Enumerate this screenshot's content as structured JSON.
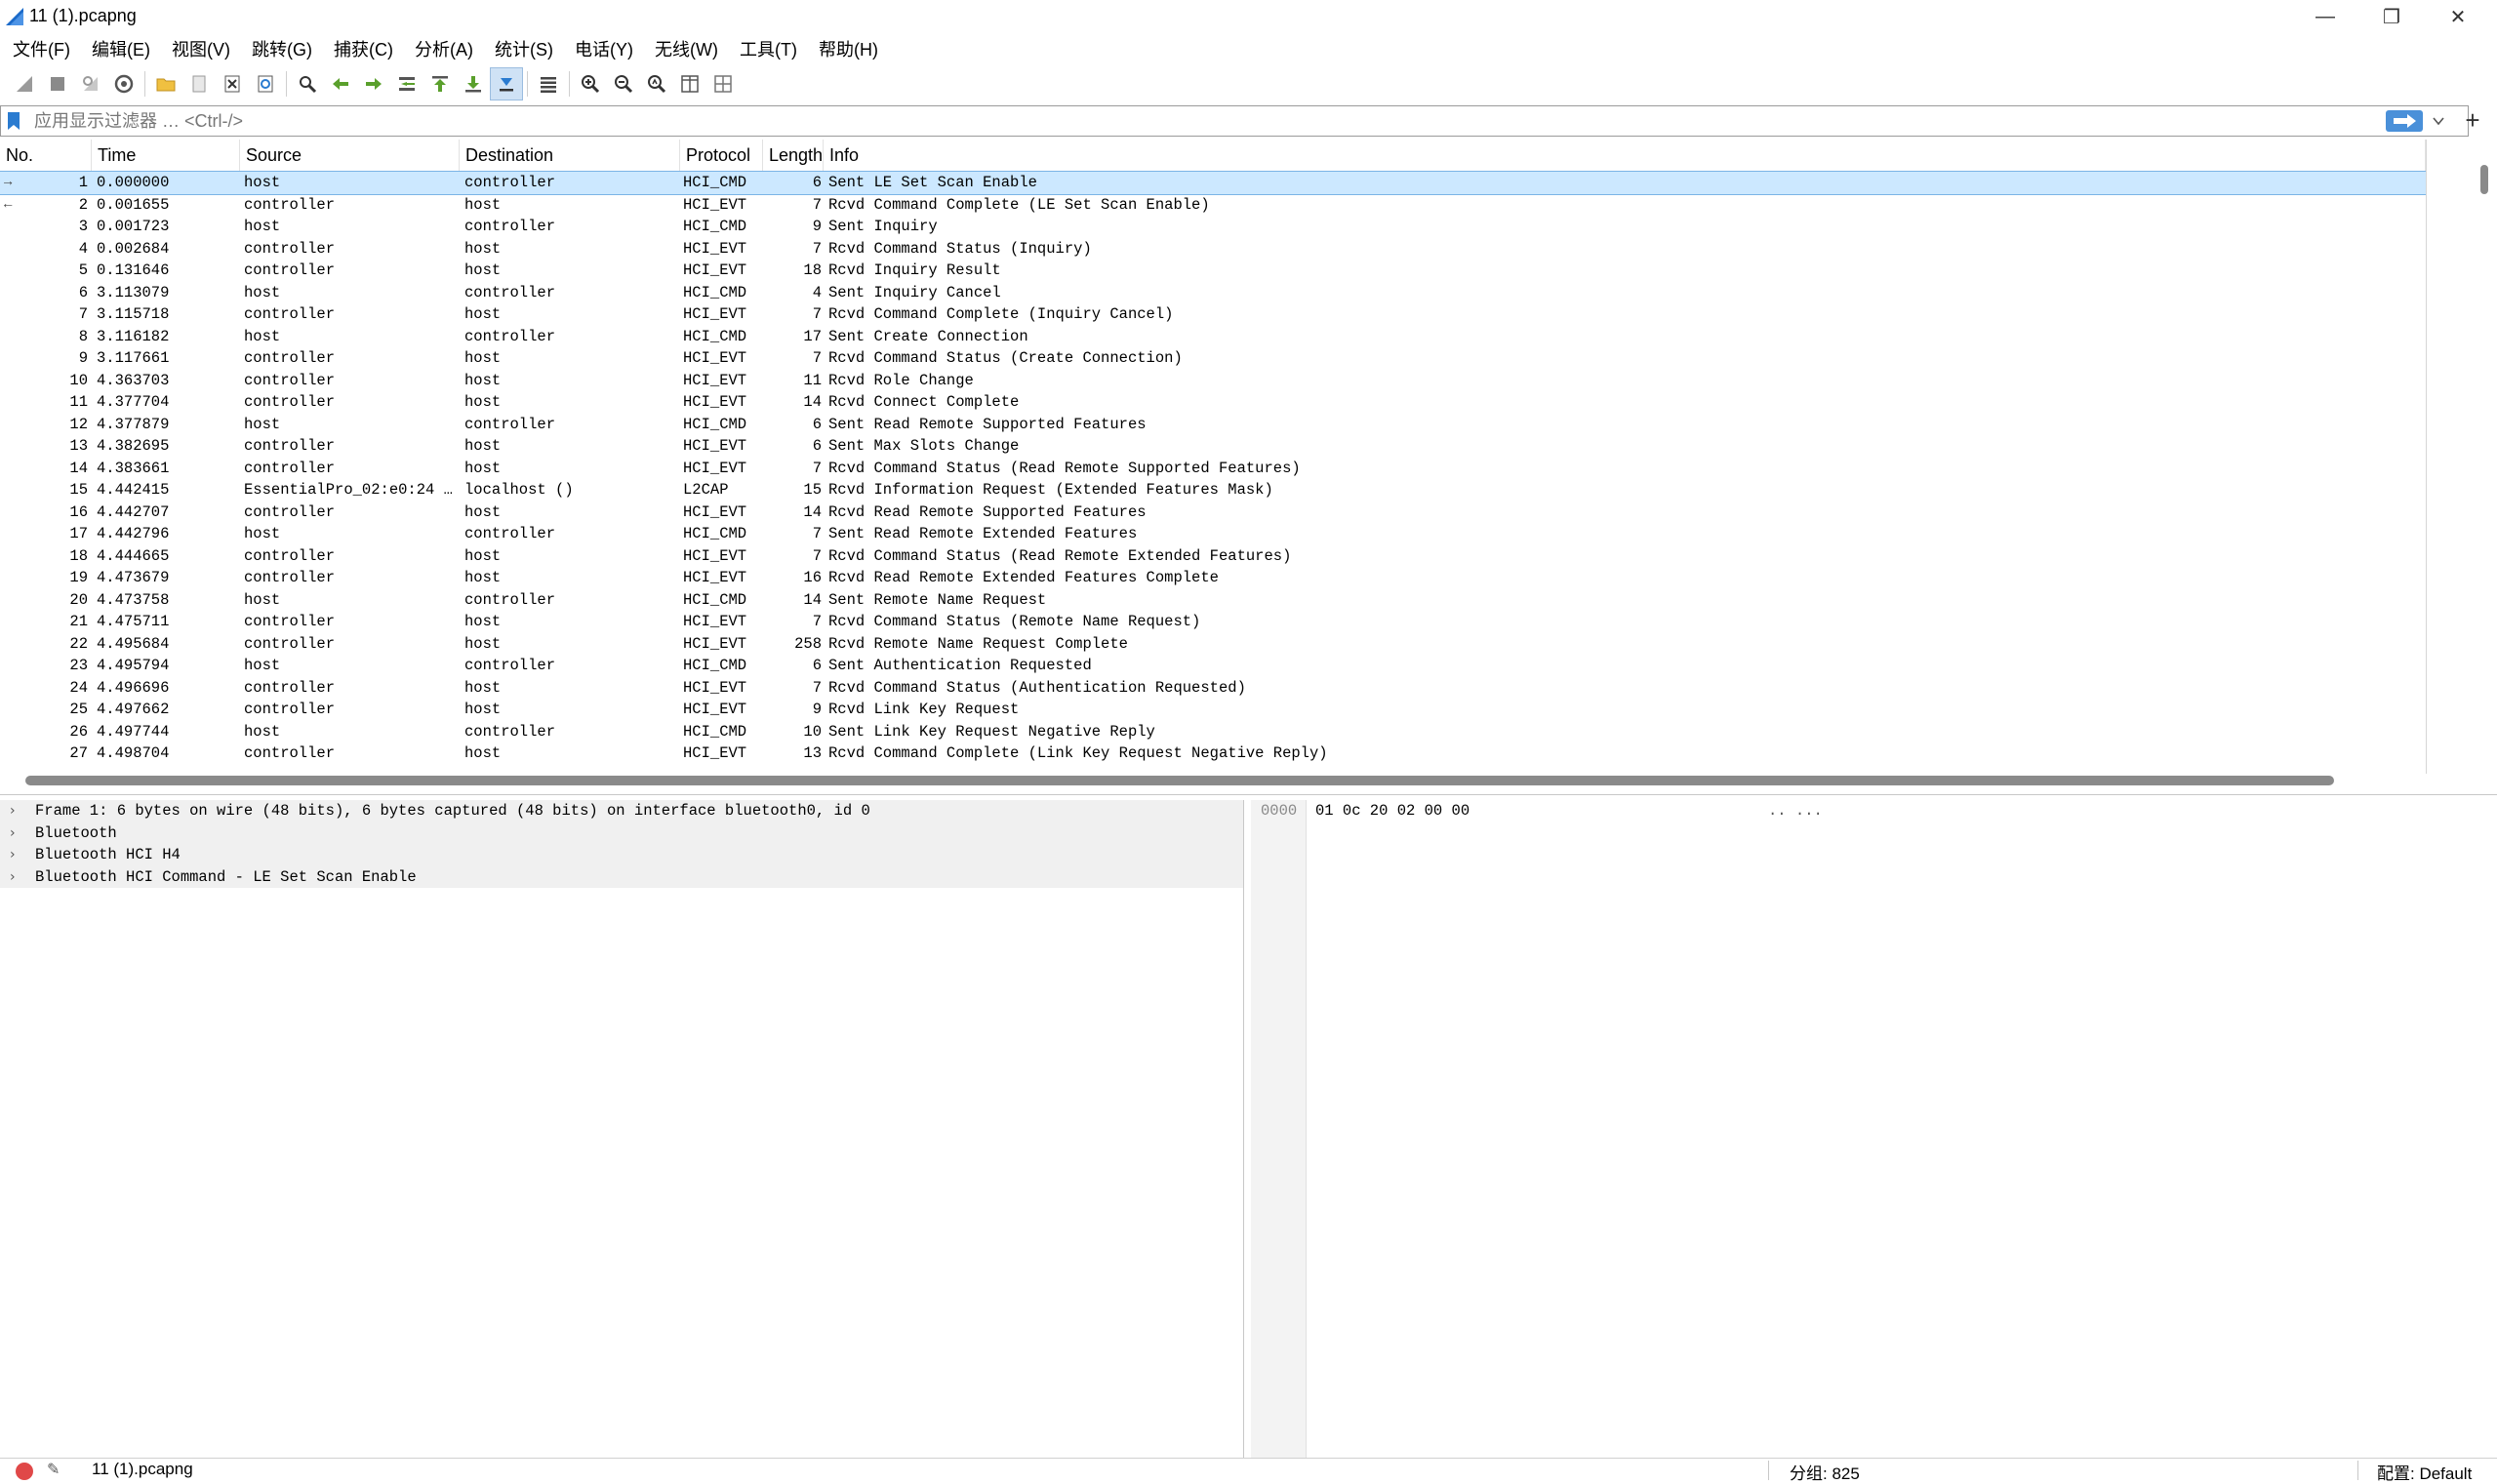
{
  "window": {
    "title": "11 (1).pcapng",
    "controls": [
      "minimize",
      "restore",
      "close"
    ]
  },
  "menu": [
    "文件(F)",
    "编辑(E)",
    "视图(V)",
    "跳转(G)",
    "捕获(C)",
    "分析(A)",
    "统计(S)",
    "电话(Y)",
    "无线(W)",
    "工具(T)",
    "帮助(H)"
  ],
  "filter": {
    "placeholder": "应用显示过滤器 … <Ctrl-/>",
    "value": "",
    "add_label": "+"
  },
  "columns": {
    "no": "No.",
    "time": "Time",
    "source": "Source",
    "destination": "Destination",
    "protocol": "Protocol",
    "length": "Length",
    "info": "Info"
  },
  "packets": [
    {
      "no": "1",
      "time": "0.000000",
      "source": "host",
      "destination": "controller",
      "protocol": "HCI_CMD",
      "length": "6",
      "info": "Sent LE Set Scan Enable",
      "mark": "→"
    },
    {
      "no": "2",
      "time": "0.001655",
      "source": "controller",
      "destination": "host",
      "protocol": "HCI_EVT",
      "length": "7",
      "info": "Rcvd Command Complete (LE Set Scan Enable)",
      "mark": "←"
    },
    {
      "no": "3",
      "time": "0.001723",
      "source": "host",
      "destination": "controller",
      "protocol": "HCI_CMD",
      "length": "9",
      "info": "Sent Inquiry",
      "mark": ""
    },
    {
      "no": "4",
      "time": "0.002684",
      "source": "controller",
      "destination": "host",
      "protocol": "HCI_EVT",
      "length": "7",
      "info": "Rcvd Command Status (Inquiry)",
      "mark": ""
    },
    {
      "no": "5",
      "time": "0.131646",
      "source": "controller",
      "destination": "host",
      "protocol": "HCI_EVT",
      "length": "18",
      "info": "Rcvd Inquiry Result",
      "mark": ""
    },
    {
      "no": "6",
      "time": "3.113079",
      "source": "host",
      "destination": "controller",
      "protocol": "HCI_CMD",
      "length": "4",
      "info": "Sent Inquiry Cancel",
      "mark": ""
    },
    {
      "no": "7",
      "time": "3.115718",
      "source": "controller",
      "destination": "host",
      "protocol": "HCI_EVT",
      "length": "7",
      "info": "Rcvd Command Complete (Inquiry Cancel)",
      "mark": ""
    },
    {
      "no": "8",
      "time": "3.116182",
      "source": "host",
      "destination": "controller",
      "protocol": "HCI_CMD",
      "length": "17",
      "info": "Sent Create Connection",
      "mark": ""
    },
    {
      "no": "9",
      "time": "3.117661",
      "source": "controller",
      "destination": "host",
      "protocol": "HCI_EVT",
      "length": "7",
      "info": "Rcvd Command Status (Create Connection)",
      "mark": ""
    },
    {
      "no": "10",
      "time": "4.363703",
      "source": "controller",
      "destination": "host",
      "protocol": "HCI_EVT",
      "length": "11",
      "info": "Rcvd Role Change",
      "mark": ""
    },
    {
      "no": "11",
      "time": "4.377704",
      "source": "controller",
      "destination": "host",
      "protocol": "HCI_EVT",
      "length": "14",
      "info": "Rcvd Connect Complete",
      "mark": ""
    },
    {
      "no": "12",
      "time": "4.377879",
      "source": "host",
      "destination": "controller",
      "protocol": "HCI_CMD",
      "length": "6",
      "info": "Sent Read Remote Supported Features",
      "mark": ""
    },
    {
      "no": "13",
      "time": "4.382695",
      "source": "controller",
      "destination": "host",
      "protocol": "HCI_EVT",
      "length": "6",
      "info": "Sent Max Slots Change",
      "mark": ""
    },
    {
      "no": "14",
      "time": "4.383661",
      "source": "controller",
      "destination": "host",
      "protocol": "HCI_EVT",
      "length": "7",
      "info": "Rcvd Command Status (Read Remote Supported Features)",
      "mark": ""
    },
    {
      "no": "15",
      "time": "4.442415",
      "source": "EssentialPro_02:e0:24 …",
      "destination": "localhost ()",
      "protocol": "L2CAP",
      "length": "15",
      "info": "Rcvd Information Request (Extended Features Mask)",
      "mark": ""
    },
    {
      "no": "16",
      "time": "4.442707",
      "source": "controller",
      "destination": "host",
      "protocol": "HCI_EVT",
      "length": "14",
      "info": "Rcvd Read Remote Supported Features",
      "mark": ""
    },
    {
      "no": "17",
      "time": "4.442796",
      "source": "host",
      "destination": "controller",
      "protocol": "HCI_CMD",
      "length": "7",
      "info": "Sent Read Remote Extended Features",
      "mark": ""
    },
    {
      "no": "18",
      "time": "4.444665",
      "source": "controller",
      "destination": "host",
      "protocol": "HCI_EVT",
      "length": "7",
      "info": "Rcvd Command Status (Read Remote Extended Features)",
      "mark": ""
    },
    {
      "no": "19",
      "time": "4.473679",
      "source": "controller",
      "destination": "host",
      "protocol": "HCI_EVT",
      "length": "16",
      "info": "Rcvd Read Remote Extended Features Complete",
      "mark": ""
    },
    {
      "no": "20",
      "time": "4.473758",
      "source": "host",
      "destination": "controller",
      "protocol": "HCI_CMD",
      "length": "14",
      "info": "Sent Remote Name Request",
      "mark": ""
    },
    {
      "no": "21",
      "time": "4.475711",
      "source": "controller",
      "destination": "host",
      "protocol": "HCI_EVT",
      "length": "7",
      "info": "Rcvd Command Status (Remote Name Request)",
      "mark": ""
    },
    {
      "no": "22",
      "time": "4.495684",
      "source": "controller",
      "destination": "host",
      "protocol": "HCI_EVT",
      "length": "258",
      "info": "Rcvd Remote Name Request Complete",
      "mark": ""
    },
    {
      "no": "23",
      "time": "4.495794",
      "source": "host",
      "destination": "controller",
      "protocol": "HCI_CMD",
      "length": "6",
      "info": "Sent Authentication Requested",
      "mark": ""
    },
    {
      "no": "24",
      "time": "4.496696",
      "source": "controller",
      "destination": "host",
      "protocol": "HCI_EVT",
      "length": "7",
      "info": "Rcvd Command Status (Authentication Requested)",
      "mark": ""
    },
    {
      "no": "25",
      "time": "4.497662",
      "source": "controller",
      "destination": "host",
      "protocol": "HCI_EVT",
      "length": "9",
      "info": "Rcvd Link Key Request",
      "mark": ""
    },
    {
      "no": "26",
      "time": "4.497744",
      "source": "host",
      "destination": "controller",
      "protocol": "HCI_CMD",
      "length": "10",
      "info": "Sent Link Key Request Negative Reply",
      "mark": ""
    },
    {
      "no": "27",
      "time": "4.498704",
      "source": "controller",
      "destination": "host",
      "protocol": "HCI_EVT",
      "length": "13",
      "info": "Rcvd Command Complete (Link Key Request Negative Reply)",
      "mark": ""
    }
  ],
  "selected_row": 0,
  "details": [
    "Frame 1: 6 bytes on wire (48 bits), 6 bytes captured (48 bits) on interface bluetooth0, id 0",
    "Bluetooth",
    "Bluetooth HCI H4",
    "Bluetooth HCI Command - LE Set Scan Enable"
  ],
  "bytes": {
    "offset": "0000",
    "hex": "01 0c 20 02 00 00",
    "ascii": ".. ..."
  },
  "status": {
    "file": "11 (1).pcapng",
    "packets": "分组: 825",
    "profile": "配置: Default"
  },
  "colors": {
    "selected_row": "#cce8ff",
    "accent": "#4a90d9",
    "status_dot": "#e04848"
  },
  "toolbar_icons": [
    "shark-start-icon",
    "stop-icon",
    "restart-icon",
    "options-icon",
    "open-folder-icon",
    "save-file-icon",
    "close-file-icon",
    "reload-icon",
    "find-icon",
    "go-back-icon",
    "go-forward-icon",
    "go-to-packet-icon",
    "go-first-icon",
    "go-last-icon",
    "auto-scroll-icon",
    "colorize-icon",
    "zoom-in-icon",
    "zoom-out-icon",
    "zoom-normal-icon",
    "resize-columns-icon",
    "layout-icon"
  ]
}
